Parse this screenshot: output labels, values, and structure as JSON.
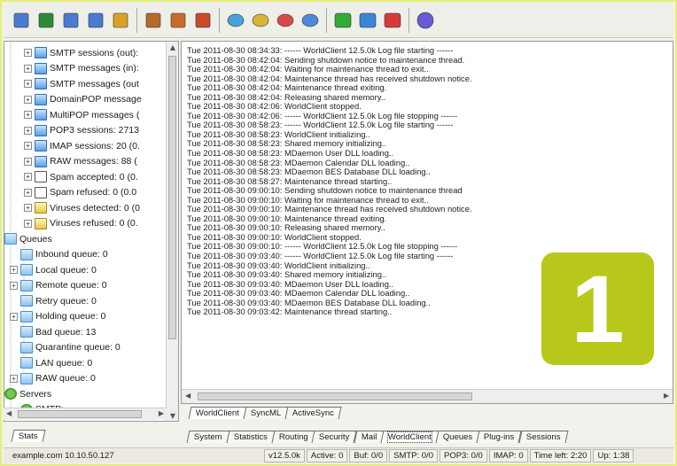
{
  "toolbar": {
    "buttons": [
      {
        "icon": "options-icon",
        "color": "#4a7bd0"
      },
      {
        "icon": "connect-icon",
        "color": "#2e8a3a"
      },
      {
        "icon": "filter-icon",
        "color": "#4a7bd0"
      },
      {
        "icon": "search-icon",
        "color": "#4a7bd0"
      },
      {
        "icon": "lock-icon",
        "color": "#d9a227"
      },
      {
        "icon": "accounts-icon",
        "color": "#b36b2a"
      },
      {
        "icon": "user-icon",
        "color": "#c86a2a"
      },
      {
        "icon": "users-icon",
        "color": "#c84a2a"
      },
      {
        "icon": "queue-refresh-icon",
        "color": "#4aa0d8"
      },
      {
        "icon": "queue-edit-icon",
        "color": "#d8b43a"
      },
      {
        "icon": "queue-remove-icon",
        "color": "#d84a4a"
      },
      {
        "icon": "queue-process-icon",
        "color": "#4a8ad8"
      },
      {
        "icon": "green-status-icon",
        "color": "#33aa33"
      },
      {
        "icon": "blue-status-icon",
        "color": "#3a86d6"
      },
      {
        "icon": "red-status-icon",
        "color": "#d63a3a"
      },
      {
        "icon": "about-icon",
        "color": "#6a5ad6"
      }
    ]
  },
  "tree": {
    "items": [
      {
        "label": "SMTP sessions (out):",
        "icon": "mail-icon",
        "expander": "+"
      },
      {
        "label": "SMTP messages (in):",
        "icon": "mail-icon",
        "expander": "+"
      },
      {
        "label": "SMTP messages (out",
        "icon": "mail-icon",
        "expander": "+"
      },
      {
        "label": "DomainPOP message",
        "icon": "mail-icon",
        "expander": "+"
      },
      {
        "label": "MultiPOP messages (",
        "icon": "mail-icon",
        "expander": "+"
      },
      {
        "label": "POP3 sessions: 2713",
        "icon": "mail-icon",
        "expander": "+"
      },
      {
        "label": "IMAP sessions: 20  (0.",
        "icon": "mail-icon",
        "expander": "+"
      },
      {
        "label": "RAW messages: 88  (",
        "icon": "mail-icon",
        "expander": "+"
      },
      {
        "label": "Spam accepted: 0  (0.",
        "icon": "spam-icon",
        "expander": "+"
      },
      {
        "label": "Spam refused: 0  (0.0",
        "icon": "spam-icon",
        "expander": "+"
      },
      {
        "label": "Viruses detected: 0  (0",
        "icon": "virus-icon",
        "expander": "+"
      },
      {
        "label": "Viruses refused: 0  (0.",
        "icon": "virus-icon",
        "expander": "+"
      },
      {
        "label": "Queues",
        "icon": "queue-folder-icon",
        "expander": "-"
      },
      {
        "label": "Inbound queue: 0",
        "icon": "queue-icon",
        "expander": ""
      },
      {
        "label": "Local queue: 0",
        "icon": "queue-icon",
        "expander": "+"
      },
      {
        "label": "Remote queue: 0",
        "icon": "queue-icon",
        "expander": "+"
      },
      {
        "label": "Retry queue: 0",
        "icon": "queue-icon",
        "expander": ""
      },
      {
        "label": "Holding queue: 0",
        "icon": "queue-icon",
        "expander": "+"
      },
      {
        "label": "Bad queue: 13",
        "icon": "queue-icon",
        "expander": ""
      },
      {
        "label": "Quarantine queue: 0",
        "icon": "queue-icon",
        "expander": ""
      },
      {
        "label": "LAN queue: 0",
        "icon": "queue-icon",
        "expander": ""
      },
      {
        "label": "RAW queue: 0",
        "icon": "queue-icon",
        "expander": "+"
      },
      {
        "label": "Servers",
        "icon": "server-icon",
        "expander": "-"
      },
      {
        "label": "SMTP: ...",
        "icon": "server-icon",
        "expander": ""
      }
    ]
  },
  "log": {
    "lines": [
      "Tue 2011-08-30 08:34:33: ------ WorldClient 12.5.0k Log file starting ------",
      "Tue 2011-08-30 08:42:04: Sending shutdown notice to maintenance thread.",
      "Tue 2011-08-30 08:42:04: Waiting for maintenance thread to exit..",
      "Tue 2011-08-30 08:42:04: Maintenance thread has received shutdown notice.",
      "Tue 2011-08-30 08:42:04: Maintenance thread exiting.",
      "Tue 2011-08-30 08:42:04: Releasing shared memory..",
      "Tue 2011-08-30 08:42:06: WorldClient stopped.",
      "Tue 2011-08-30 08:42:06: ------ WorldClient 12.5.0k Log file stopping ------",
      "Tue 2011-08-30 08:58:23: ------ WorldClient 12.5.0k Log file starting ------",
      "Tue 2011-08-30 08:58:23: WorldClient initializing..",
      "Tue 2011-08-30 08:58:23: Shared memory initializing..",
      "Tue 2011-08-30 08:58:23: MDaemon User DLL loading..",
      "Tue 2011-08-30 08:58:23: MDaemon Calendar DLL loading..",
      "Tue 2011-08-30 08:58:23: MDaemon BES Database DLL loading..",
      "Tue 2011-08-30 08:58:27: Maintenance thread starting..",
      "Tue 2011-08-30 09:00:10: Sending shutdown notice to maintenance thread",
      "Tue 2011-08-30 09:00:10: Waiting for maintenance thread to exit..",
      "Tue 2011-08-30 09:00:10: Maintenance thread has received shutdown notice.",
      "Tue 2011-08-30 09:00:10: Maintenance thread exiting.",
      "Tue 2011-08-30 09:00:10: Releasing shared memory..",
      "Tue 2011-08-30 09:00:10: WorldClient stopped.",
      "Tue 2011-08-30 09:00:10: ------ WorldClient 12.5.0k Log file stopping ------",
      "Tue 2011-08-30 09:03:40: ------ WorldClient 12.5.0k Log file starting ------",
      "Tue 2011-08-30 09:03:40: WorldClient initializing..",
      "Tue 2011-08-30 09:03:40: Shared memory initializing..",
      "Tue 2011-08-30 09:03:40: MDaemon User DLL loading..",
      "Tue 2011-08-30 09:03:40: MDaemon Calendar DLL loading..",
      "Tue 2011-08-30 09:03:40: MDaemon BES Database DLL loading..",
      "Tue 2011-08-30 09:03:42: Maintenance thread starting.."
    ]
  },
  "badge": {
    "text": "1",
    "color": "#b8c81a"
  },
  "log_tabs": [
    "WorldClient",
    "SyncML",
    "ActiveSync"
  ],
  "left_tabs": [
    "Stats"
  ],
  "main_tabs": [
    "System",
    "Statistics",
    "Routing",
    "Security",
    "Mail",
    "WorldClient",
    "Queues",
    "Plug-ins",
    "Sessions"
  ],
  "main_tabs_active": "WorldClient",
  "status": {
    "host": "example.com 10.10.50.127",
    "cells": [
      "v12.5.0k",
      "Active: 0",
      "Buf: 0/0",
      "SMTP: 0/0",
      "POP3: 0/0",
      "IMAP: 0",
      "Time left: 2:20",
      "Up: 1:38"
    ]
  }
}
